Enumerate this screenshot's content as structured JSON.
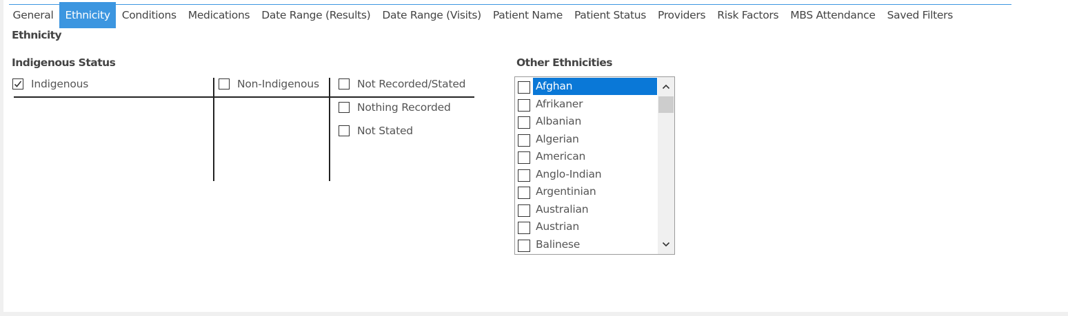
{
  "tabs": [
    {
      "label": "General",
      "active": false
    },
    {
      "label": "Ethnicity",
      "active": true
    },
    {
      "label": "Conditions",
      "active": false
    },
    {
      "label": "Medications",
      "active": false
    },
    {
      "label": "Date Range (Results)",
      "active": false
    },
    {
      "label": "Date Range (Visits)",
      "active": false
    },
    {
      "label": "Patient Name",
      "active": false
    },
    {
      "label": "Patient Status",
      "active": false
    },
    {
      "label": "Providers",
      "active": false
    },
    {
      "label": "Risk Factors",
      "active": false
    },
    {
      "label": "MBS Attendance",
      "active": false
    },
    {
      "label": "Saved Filters",
      "active": false
    }
  ],
  "section_title": "Ethnicity",
  "indigenous_status": {
    "title": "Indigenous Status",
    "options": [
      {
        "label": "Indigenous",
        "checked": true
      },
      {
        "label": "Non-Indigenous",
        "checked": false
      },
      {
        "label": "Not Recorded/Stated",
        "checked": false
      },
      {
        "label": "Nothing Recorded",
        "checked": false
      },
      {
        "label": "Not Stated",
        "checked": false
      }
    ]
  },
  "other_ethnicities": {
    "title": "Other Ethnicities",
    "items": [
      {
        "label": "Afghan",
        "checked": false,
        "selected": true
      },
      {
        "label": "Afrikaner",
        "checked": false,
        "selected": false
      },
      {
        "label": "Albanian",
        "checked": false,
        "selected": false
      },
      {
        "label": "Algerian",
        "checked": false,
        "selected": false
      },
      {
        "label": "American",
        "checked": false,
        "selected": false
      },
      {
        "label": "Anglo-Indian",
        "checked": false,
        "selected": false
      },
      {
        "label": "Argentinian",
        "checked": false,
        "selected": false
      },
      {
        "label": "Australian",
        "checked": false,
        "selected": false
      },
      {
        "label": "Austrian",
        "checked": false,
        "selected": false
      },
      {
        "label": "Balinese",
        "checked": false,
        "selected": false
      }
    ]
  },
  "colors": {
    "accent": "#3c96e0",
    "selection": "#0a78d7"
  }
}
